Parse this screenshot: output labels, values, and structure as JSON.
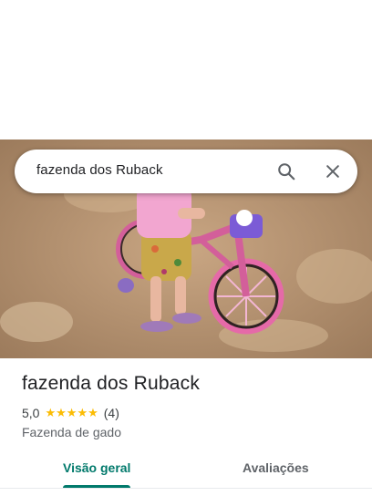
{
  "search": {
    "query": "fazenda dos Ruback",
    "search_icon": "search-icon",
    "close_icon": "close-icon"
  },
  "hero_photo": {
    "description_icon": "photo"
  },
  "place": {
    "name": "fazenda dos Ruback",
    "rating": "5,0",
    "stars": 5,
    "review_count": "(4)",
    "category": "Fazenda de gado"
  },
  "tabs": [
    {
      "label": "Visão geral",
      "active": true
    },
    {
      "label": "Avaliações",
      "active": false
    }
  ],
  "colors": {
    "accent": "#00796b",
    "star": "#fbbc04"
  }
}
